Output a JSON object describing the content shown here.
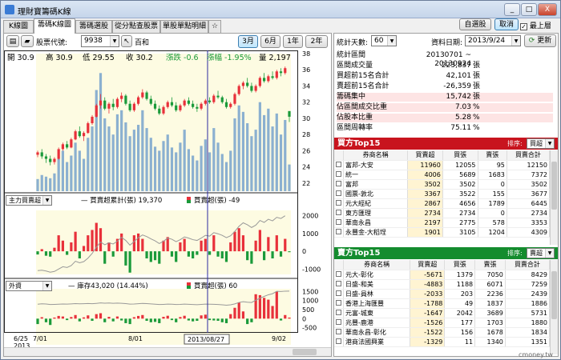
{
  "window": {
    "title": "理財寶籌碼K線",
    "btn_min": "_",
    "btn_max": "□",
    "btn_close": "X"
  },
  "tabs": [
    "K線圖",
    "籌碼K線圖",
    "籌碼選股",
    "從分點查股票",
    "單股單點明細",
    "☆"
  ],
  "toolbar": {
    "stock_label": "股票代號:",
    "stock_code": "9938",
    "stock_name": "百和",
    "range_buttons": [
      "3月",
      "6月",
      "1年",
      "2年"
    ],
    "selected_range": "3月"
  },
  "top_right": {
    "btn_pick": "自選股",
    "btn_close": "取消",
    "always_top": "最上層"
  },
  "quote": {
    "open_label": "開",
    "open": "30.9",
    "high_label": "高",
    "high": "30.9",
    "low_label": "低",
    "low": "29.55",
    "close_label": "收",
    "close": "30.2",
    "chg_label": "漲跌",
    "chg": "-0.6",
    "pct_label": "漲幅",
    "pct": "-1.95%",
    "vol_label": "量",
    "vol": "2,197"
  },
  "price_axis": [
    "38",
    "36",
    "34",
    "32",
    "30",
    "28",
    "26",
    "24",
    "22"
  ],
  "mid_panel": {
    "select": "主力買賣超",
    "legend1": "買賣超累計(張)",
    "legend1_val": "19,370",
    "legend2": "買賣超(張)",
    "legend2_val": "-49",
    "axis": [
      "2000",
      "1000",
      "0",
      "-1000"
    ]
  },
  "bot_panel": {
    "select": "外資",
    "legend1": "庫存43,020 (14.44%)",
    "legend2": "買賣超(張)",
    "legend2_val": "60",
    "axis": [
      "1500",
      "1000",
      "500",
      "0",
      "-500"
    ]
  },
  "x_axis": {
    "labels": [
      "6/25",
      "7/01",
      "8/01",
      "9/02"
    ],
    "year": "2013",
    "cursor_date": "2013/08/27"
  },
  "stats_controls": {
    "days_label": "統計天數:",
    "days": "60",
    "date_label": "資料日期:",
    "date": "2013/9/24",
    "refresh": "更新"
  },
  "stats": [
    {
      "k": "統計區間",
      "v": "20130701 ~ 20130924",
      "u": "",
      "pink": false
    },
    {
      "k": "區間成交量",
      "v": "223,837",
      "u": "張",
      "pink": false
    },
    {
      "k": "買超前15名合計",
      "v": "42,101",
      "u": "張",
      "pink": false
    },
    {
      "k": "賣超前15名合計",
      "v": "-26,359",
      "u": "張",
      "pink": false
    },
    {
      "k": "籌碼集中",
      "v": "15,742",
      "u": "張",
      "pink": true
    },
    {
      "k": "佔區間成交比重",
      "v": "7.03",
      "u": "%",
      "pink": true
    },
    {
      "k": "佔股本比重",
      "v": "5.28",
      "u": "%",
      "pink": true
    },
    {
      "k": "區間周轉率",
      "v": "75.11",
      "u": "%",
      "pink": false
    }
  ],
  "buy_panel": {
    "title": "買方Top15",
    "sort_label": "排序:",
    "sort": "買超",
    "cols": [
      "券商名稱",
      "買賣超",
      "買張",
      "賣張",
      "買賣合計"
    ],
    "rows": [
      [
        "富邦-大安",
        "11960",
        "12055",
        "95",
        "12150"
      ],
      [
        "統一",
        "4006",
        "5689",
        "1683",
        "7372"
      ],
      [
        "富邦",
        "3502",
        "3502",
        "0",
        "3502"
      ],
      [
        "國票-敦北",
        "3367",
        "3522",
        "155",
        "3677"
      ],
      [
        "元大經紀",
        "2867",
        "4656",
        "1789",
        "6445"
      ],
      [
        "東方匯理",
        "2734",
        "2734",
        "0",
        "2734"
      ],
      [
        "華南永昌",
        "2197",
        "2775",
        "578",
        "3353"
      ],
      [
        "永豐金-大稻埕",
        "1901",
        "3105",
        "1204",
        "4309"
      ]
    ]
  },
  "sell_panel": {
    "title": "賣方Top15",
    "sort_label": "排序:",
    "sort": "賣超",
    "cols": [
      "券商名稱",
      "買賣超",
      "買張",
      "賣張",
      "買賣合計"
    ],
    "rows": [
      [
        "元大-彰化",
        "-5671",
        "1379",
        "7050",
        "8429"
      ],
      [
        "日盛-和美",
        "-4883",
        "1188",
        "6071",
        "7259"
      ],
      [
        "日盛-員林",
        "-2033",
        "203",
        "2236",
        "2439"
      ],
      [
        "香港上海匯豐",
        "-1788",
        "49",
        "1837",
        "1886"
      ],
      [
        "元富-城東",
        "-1647",
        "2042",
        "3689",
        "5731"
      ],
      [
        "兆豐-鹿港",
        "-1526",
        "177",
        "1703",
        "1880"
      ],
      [
        "華南永昌-彰化",
        "-1522",
        "156",
        "1678",
        "1834"
      ],
      [
        "港商法國興業",
        "-1329",
        "11",
        "1340",
        "1351"
      ]
    ]
  },
  "watermark": "cmoney.tw",
  "colors": {
    "up": "#e8303a",
    "down": "#1a9a3a",
    "vol": "#8bb0d0",
    "buy_header": "#c8141e",
    "sell_header": "#148c2e"
  },
  "chart_data": {
    "type": "candlestick",
    "x_labels": [
      "6/25",
      "7/01",
      "8/01",
      "9/02"
    ],
    "price_ylim": [
      21,
      38
    ],
    "price": [
      [
        25.5,
        26,
        25.2,
        25.8
      ],
      [
        25.8,
        26.2,
        25,
        25.3
      ],
      [
        25.3,
        25.6,
        24.5,
        25.0
      ],
      [
        25,
        25.4,
        24.2,
        24.6
      ],
      [
        24.6,
        25.2,
        24.3,
        25.0
      ],
      [
        25,
        26.4,
        24.9,
        26.2
      ],
      [
        26.2,
        27,
        26,
        26.8
      ],
      [
        26.8,
        27.2,
        26.2,
        26.4
      ],
      [
        26.4,
        27.6,
        26.3,
        27.4
      ],
      [
        27.4,
        28.6,
        27.3,
        28.4
      ],
      [
        28.4,
        29,
        27.6,
        27.8
      ],
      [
        27.8,
        28.4,
        27.2,
        28.2
      ],
      [
        28.2,
        29.6,
        28.1,
        29.4
      ],
      [
        29.4,
        30.4,
        29.2,
        30.2
      ],
      [
        30.2,
        31.8,
        30.1,
        31.6
      ],
      [
        31.6,
        33,
        31.2,
        32.2
      ],
      [
        32.2,
        32.6,
        31,
        31.2
      ],
      [
        31.2,
        32,
        30.6,
        31.8
      ],
      [
        31.8,
        32.4,
        31,
        31.4
      ],
      [
        31.4,
        32.6,
        31.2,
        32.4
      ],
      [
        32.4,
        33.2,
        32,
        32.8
      ],
      [
        32.8,
        33,
        31.6,
        31.8
      ],
      [
        31.8,
        32.2,
        30.8,
        31.0
      ],
      [
        31,
        32,
        30.8,
        31.8
      ],
      [
        31.8,
        32.8,
        31.6,
        32.6
      ],
      [
        32.6,
        33.6,
        32.4,
        33.2
      ],
      [
        33.2,
        33.4,
        32.2,
        32.4
      ],
      [
        32.4,
        32.8,
        31.6,
        31.8
      ],
      [
        31.8,
        32.2,
        31,
        31.2
      ],
      [
        31.2,
        31.6,
        30.4,
        30.6
      ],
      [
        30.6,
        31.6,
        30.4,
        31.4
      ],
      [
        31.4,
        32.2,
        31.2,
        32
      ],
      [
        32,
        32.6,
        31.4,
        31.6
      ],
      [
        31.6,
        32,
        30.8,
        31.0
      ],
      [
        31,
        31.8,
        30.8,
        31.6
      ],
      [
        31.6,
        32.4,
        31.4,
        32.2
      ],
      [
        32.2,
        32.6,
        31.6,
        31.8
      ],
      [
        31.8,
        32.2,
        31.2,
        31.4
      ],
      [
        31.4,
        31.8,
        30.8,
        31.2
      ],
      [
        31.2,
        32,
        31,
        31.8
      ],
      [
        31.8,
        32.4,
        31.6,
        32.2
      ],
      [
        32.2,
        32.6,
        31.8,
        32
      ],
      [
        32,
        33,
        31.8,
        32.8
      ],
      [
        32.8,
        33.4,
        32.4,
        32.6
      ],
      [
        32.6,
        32.8,
        31.8,
        32
      ],
      [
        32,
        32.4,
        31.2,
        31.4
      ],
      [
        31.4,
        32,
        31.2,
        31.8
      ],
      [
        31.8,
        33.2,
        31.6,
        33
      ],
      [
        33,
        34.2,
        32.8,
        34
      ],
      [
        34,
        34.6,
        33.6,
        34.4
      ],
      [
        34.4,
        35,
        33.8,
        34.0
      ],
      [
        34,
        34.4,
        33.2,
        33.4
      ],
      [
        33.4,
        34.2,
        33.2,
        34
      ],
      [
        34,
        35.2,
        33.8,
        35
      ],
      [
        35,
        35.6,
        34.4,
        34.6
      ],
      [
        34.6,
        35.4,
        34.4,
        35.2
      ],
      [
        35.2,
        35.8,
        34.8,
        35.0
      ],
      [
        35,
        36,
        34.8,
        35.8
      ],
      [
        35.8,
        36.2,
        35.2,
        35.6
      ],
      [
        35.6,
        36.4,
        35.4,
        36.2
      ],
      [
        30.9,
        30.9,
        29.55,
        30.2
      ]
    ],
    "volume": [
      22.5,
      23,
      22.8,
      22.6,
      23.2,
      25,
      26,
      24.6,
      25.4,
      27,
      26,
      25,
      27.6,
      29,
      33.5,
      35.6,
      30,
      29,
      28,
      30.5,
      31,
      29.5,
      27.8,
      28.6,
      29.2,
      31,
      28.8,
      27.6,
      26.5,
      26,
      27.2,
      28,
      26.4,
      25.8,
      27,
      28.6,
      26.2,
      25.4,
      24.8,
      26.6,
      27.4,
      25.8,
      28.8,
      27,
      25.6,
      24.6,
      26,
      30,
      31.6,
      30.8,
      29.4,
      27.8,
      28.6,
      32,
      30.4,
      31.2,
      29,
      30.6,
      28,
      29.8,
      24.3
    ],
    "mid_net": [
      -180,
      120,
      -250,
      -300,
      200,
      900,
      600,
      -200,
      500,
      1100,
      -400,
      300,
      900,
      1200,
      1600,
      1300,
      -700,
      500,
      -300,
      700,
      1000,
      -800,
      -1200,
      900,
      1000,
      700,
      -400,
      -600,
      -500,
      -700,
      600,
      800,
      -300,
      -600,
      500,
      700,
      -300,
      -400,
      -200,
      600,
      700,
      -200,
      900,
      -300,
      -400,
      -600,
      500,
      1100,
      1300,
      900,
      -500,
      -700,
      600,
      1200,
      -500,
      800,
      -400,
      900,
      -300,
      700,
      -49
    ],
    "mid_cum": [
      -400,
      -300,
      -500,
      -800,
      -600,
      0,
      600,
      400,
      900,
      2000,
      1600,
      1900,
      2800,
      4000,
      5600,
      6900,
      6200,
      6700,
      6400,
      7100,
      8100,
      7300,
      6100,
      7000,
      8000,
      8700,
      8300,
      7700,
      7200,
      6500,
      7100,
      7900,
      7600,
      7000,
      7500,
      8200,
      7900,
      7500,
      7300,
      7900,
      8600,
      8400,
      9300,
      9000,
      8600,
      8000,
      8500,
      9600,
      10900,
      11800,
      11300,
      10600,
      11200,
      12400,
      11900,
      12700,
      12300,
      13200,
      12900,
      13600,
      19370
    ],
    "bot_net": [
      -300,
      80,
      -200,
      -350,
      60,
      150,
      120,
      -80,
      90,
      200,
      -150,
      70,
      180,
      -120,
      250,
      300,
      -200,
      100,
      -150,
      120,
      -100,
      -250,
      -300,
      80,
      150,
      200,
      -120,
      -200,
      -180,
      -250,
      100,
      160,
      -80,
      -200,
      90,
      160,
      -100,
      -150,
      -120,
      180,
      220,
      -80,
      -100,
      -120,
      -200,
      -250,
      250,
      600,
      900,
      400,
      -300,
      -200,
      1350,
      1300,
      1150,
      1050,
      700,
      1500,
      -100,
      200,
      60
    ],
    "bot_inv": [
      800,
      820,
      810,
      780,
      790,
      800,
      810,
      805,
      815,
      830,
      820,
      825,
      835,
      825,
      845,
      870,
      855,
      865,
      850,
      860,
      850,
      830,
      805,
      812,
      825,
      840,
      830,
      815,
      800,
      780,
      790,
      805,
      800,
      782,
      790,
      805,
      795,
      782,
      770,
      785,
      805,
      800,
      792,
      782,
      765,
      745,
      765,
      815,
      895,
      935,
      910,
      895,
      1015,
      1130,
      1230,
      1320,
      1380,
      1510,
      1500,
      1520,
      1525
    ],
    "mid_axis": [
      -1000,
      0,
      1000,
      2000
    ],
    "bot_axis": [
      -500,
      0,
      500,
      1000,
      1500
    ]
  }
}
